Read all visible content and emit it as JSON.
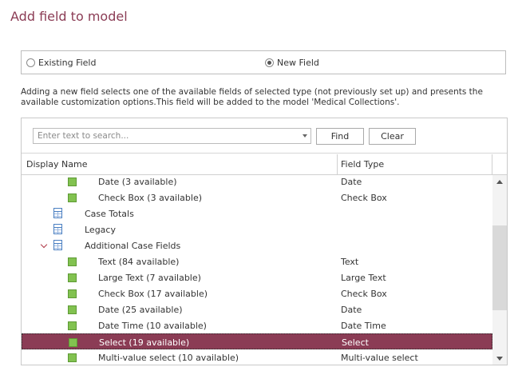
{
  "dialog": {
    "title": "Add field to model"
  },
  "mode": {
    "existing_label": "Existing Field",
    "new_label": "New Field",
    "selected": "new"
  },
  "description": "Adding a new field selects one of the available fields of selected type (not previously set up) and presents the available customization options.This field will be added to the model 'Medical Collections'.",
  "search": {
    "placeholder": "Enter text to search...",
    "value": "",
    "find_label": "Find",
    "clear_label": "Clear"
  },
  "columns": {
    "name": "Display Name",
    "type": "Field Type"
  },
  "rows": [
    {
      "name": "Date (3 available)",
      "type": "Date",
      "icon": "field-icon",
      "level": 2,
      "selected": false
    },
    {
      "name": "Check Box (3 available)",
      "type": "Check Box",
      "icon": "field-icon",
      "level": 2,
      "selected": false
    },
    {
      "name": "Case Totals",
      "type": "",
      "icon": "table-icon",
      "level": 1,
      "selected": false
    },
    {
      "name": "Legacy",
      "type": "",
      "icon": "table-icon",
      "level": 1,
      "selected": false
    },
    {
      "name": "Additional Case Fields",
      "type": "",
      "icon": "table-icon",
      "level": 1,
      "expanded": true,
      "selected": false
    },
    {
      "name": "Text (84 available)",
      "type": "Text",
      "icon": "field-icon",
      "level": 2,
      "selected": false
    },
    {
      "name": "Large Text (7 available)",
      "type": "Large Text",
      "icon": "field-icon",
      "level": 2,
      "selected": false
    },
    {
      "name": "Check Box (17 available)",
      "type": "Check Box",
      "icon": "field-icon",
      "level": 2,
      "selected": false
    },
    {
      "name": "Date (25 available)",
      "type": "Date",
      "icon": "field-icon",
      "level": 2,
      "selected": false
    },
    {
      "name": "Date Time (10 available)",
      "type": "Date Time",
      "icon": "field-icon",
      "level": 2,
      "selected": false
    },
    {
      "name": "Select (19 available)",
      "type": "Select",
      "icon": "field-icon",
      "level": 2,
      "selected": true
    },
    {
      "name": "Multi-value select (10 available)",
      "type": "Multi-value select",
      "icon": "field-icon",
      "level": 2,
      "selected": false
    }
  ],
  "colors": {
    "accent": "#8b3c55",
    "field_icon": "#82c250",
    "table_icon": "#4a7fc1"
  }
}
